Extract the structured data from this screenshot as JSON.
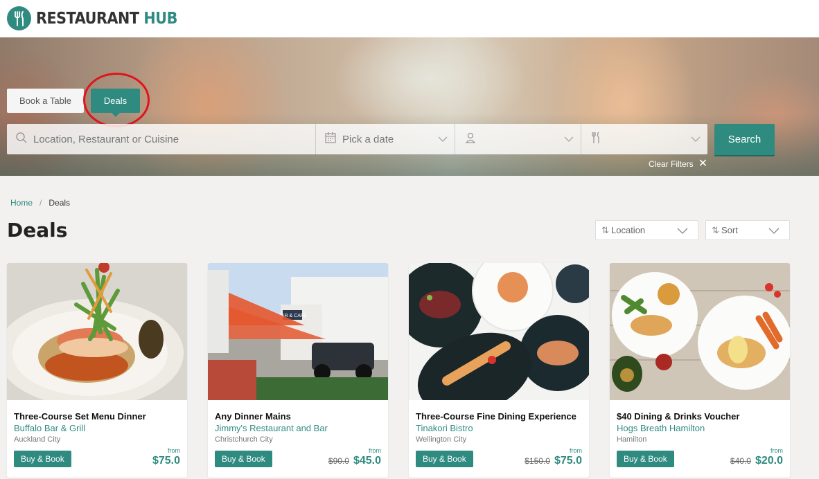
{
  "header": {
    "brand_part1": "RESTAURANT",
    "brand_part2": "HUB"
  },
  "hero": {
    "tabs": [
      {
        "label": "Book a Table",
        "active": false
      },
      {
        "label": "Deals",
        "active": true
      }
    ],
    "search": {
      "location_placeholder": "Location, Restaurant or Cuisine",
      "date_placeholder": "Pick a date",
      "guests_value": "",
      "meal_value": "",
      "button_label": "Search"
    },
    "clear_filters_label": "Clear Filters",
    "annotation_color": "#e0141c"
  },
  "breadcrumb": {
    "home": "Home",
    "separator": "/",
    "current": "Deals"
  },
  "page_title": "Deals",
  "filters": {
    "location_label": "Location",
    "sort_label": "Sort"
  },
  "colors": {
    "accent": "#2f8a80",
    "background": "#f2f1ef"
  },
  "cards": [
    {
      "title": "Three-Course Set Menu Dinner",
      "restaurant": "Buffalo Bar & Grill",
      "city": "Auckland City",
      "button": "Buy & Book",
      "from": "from",
      "old_price": "",
      "price": "$75.0"
    },
    {
      "title": "Any Dinner Mains",
      "restaurant": "Jimmy's Restaurant and Bar",
      "city": "Christchurch City",
      "button": "Buy & Book",
      "from": "from",
      "old_price": "$90.0",
      "price": "$45.0",
      "sign_text": "BAR & CAFÉ"
    },
    {
      "title": "Three-Course Fine Dining Experience",
      "restaurant": "Tinakori Bistro",
      "city": "Wellington City",
      "button": "Buy & Book",
      "from": "from",
      "old_price": "$150.0",
      "price": "$75.0"
    },
    {
      "title": "$40 Dining & Drinks Voucher",
      "restaurant": "Hogs Breath Hamilton",
      "city": "Hamilton",
      "button": "Buy & Book",
      "from": "from",
      "old_price": "$40.0",
      "price": "$20.0"
    }
  ]
}
